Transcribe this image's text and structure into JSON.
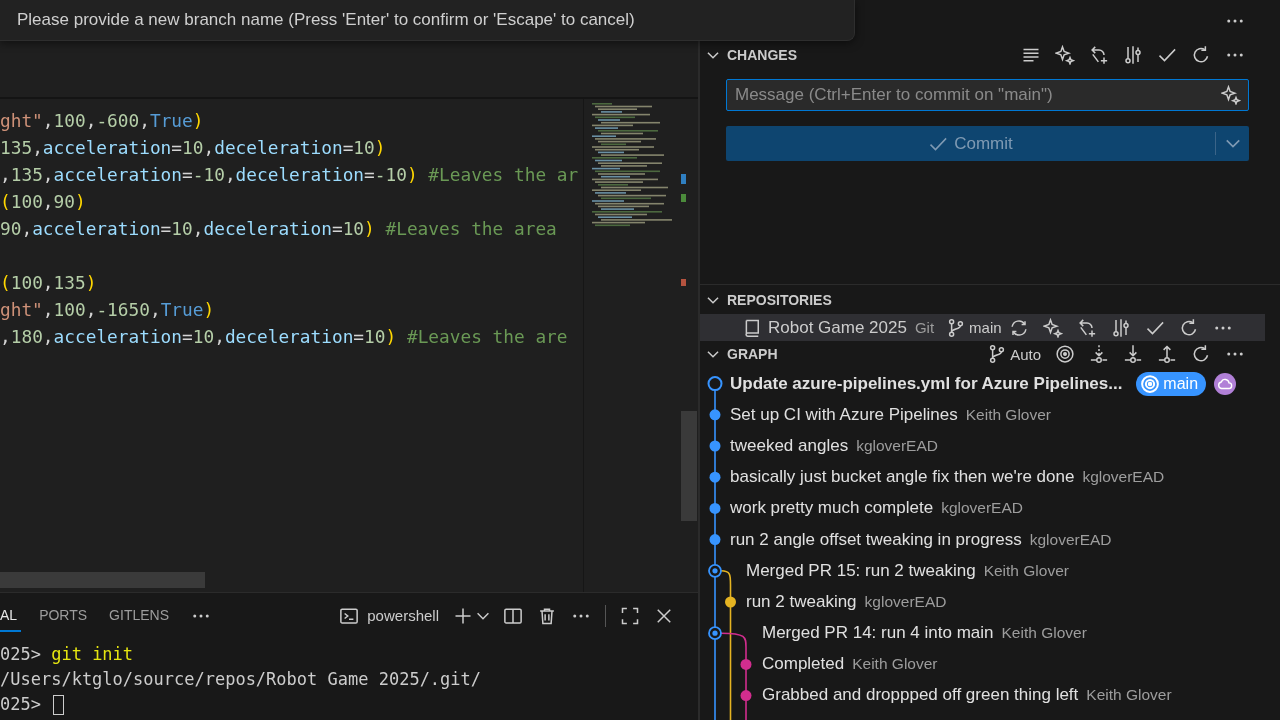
{
  "quick_input": {
    "message": "Please provide a new branch name (Press 'Enter' to confirm or 'Escape' to cancel)"
  },
  "editor": {
    "lines": [
      {
        "kind": "code",
        "segments": [
          {
            "kind": "str",
            "text": "ght\""
          },
          {
            "kind": "punc",
            "text": ","
          },
          {
            "kind": "num",
            "text": "100"
          },
          {
            "kind": "punc",
            "text": ","
          },
          {
            "kind": "num",
            "text": "-600"
          },
          {
            "kind": "punc",
            "text": ","
          },
          {
            "kind": "kw",
            "text": "True"
          },
          {
            "kind": "paren",
            "text": ")"
          }
        ]
      },
      {
        "kind": "code",
        "segments": [
          {
            "kind": "num",
            "text": "135"
          },
          {
            "kind": "punc",
            "text": ","
          },
          {
            "kind": "param",
            "text": "acceleration"
          },
          {
            "kind": "punc",
            "text": "="
          },
          {
            "kind": "num",
            "text": "10"
          },
          {
            "kind": "punc",
            "text": ","
          },
          {
            "kind": "param",
            "text": "deceleration"
          },
          {
            "kind": "punc",
            "text": "="
          },
          {
            "kind": "num",
            "text": "10"
          },
          {
            "kind": "paren",
            "text": ")"
          }
        ]
      },
      {
        "kind": "code",
        "segments": [
          {
            "kind": "punc",
            "text": ","
          },
          {
            "kind": "num",
            "text": "135"
          },
          {
            "kind": "punc",
            "text": ","
          },
          {
            "kind": "param",
            "text": "acceleration"
          },
          {
            "kind": "punc",
            "text": "="
          },
          {
            "kind": "num",
            "text": "-10"
          },
          {
            "kind": "punc",
            "text": ","
          },
          {
            "kind": "param",
            "text": "deceleration"
          },
          {
            "kind": "punc",
            "text": "="
          },
          {
            "kind": "num",
            "text": "-10"
          },
          {
            "kind": "paren",
            "text": ")"
          },
          {
            "kind": "com",
            "text": " #Leaves the ar"
          }
        ]
      },
      {
        "kind": "code",
        "segments": [
          {
            "kind": "paren",
            "text": "("
          },
          {
            "kind": "num",
            "text": "100"
          },
          {
            "kind": "punc",
            "text": ","
          },
          {
            "kind": "num",
            "text": "90"
          },
          {
            "kind": "paren",
            "text": ")"
          }
        ]
      },
      {
        "kind": "code",
        "segments": [
          {
            "kind": "num",
            "text": "90"
          },
          {
            "kind": "punc",
            "text": ","
          },
          {
            "kind": "param",
            "text": "acceleration"
          },
          {
            "kind": "punc",
            "text": "="
          },
          {
            "kind": "num",
            "text": "10"
          },
          {
            "kind": "punc",
            "text": ","
          },
          {
            "kind": "param",
            "text": "deceleration"
          },
          {
            "kind": "punc",
            "text": "="
          },
          {
            "kind": "num",
            "text": "10"
          },
          {
            "kind": "paren",
            "text": ")"
          },
          {
            "kind": "com",
            "text": " #Leaves the area"
          }
        ]
      },
      {
        "kind": "blank"
      },
      {
        "kind": "code",
        "segments": [
          {
            "kind": "paren",
            "text": "("
          },
          {
            "kind": "num",
            "text": "100"
          },
          {
            "kind": "punc",
            "text": ","
          },
          {
            "kind": "num",
            "text": "135"
          },
          {
            "kind": "paren",
            "text": ")"
          }
        ]
      },
      {
        "kind": "code",
        "segments": [
          {
            "kind": "str",
            "text": "ght\""
          },
          {
            "kind": "punc",
            "text": ","
          },
          {
            "kind": "num",
            "text": "100"
          },
          {
            "kind": "punc",
            "text": ","
          },
          {
            "kind": "num",
            "text": "-1650"
          },
          {
            "kind": "punc",
            "text": ","
          },
          {
            "kind": "kw",
            "text": "True"
          },
          {
            "kind": "paren",
            "text": ")"
          }
        ]
      },
      {
        "kind": "code",
        "segments": [
          {
            "kind": "punc",
            "text": ","
          },
          {
            "kind": "num",
            "text": "180"
          },
          {
            "kind": "punc",
            "text": ","
          },
          {
            "kind": "param",
            "text": "acceleration"
          },
          {
            "kind": "punc",
            "text": "="
          },
          {
            "kind": "num",
            "text": "10"
          },
          {
            "kind": "punc",
            "text": ","
          },
          {
            "kind": "param",
            "text": "deceleration"
          },
          {
            "kind": "punc",
            "text": "="
          },
          {
            "kind": "num",
            "text": "10"
          },
          {
            "kind": "paren",
            "text": ")"
          },
          {
            "kind": "com",
            "text": " #Leaves the are"
          }
        ]
      }
    ]
  },
  "panel": {
    "tabs": [
      {
        "label": "AL",
        "selected": true
      },
      {
        "label": "PORTS",
        "selected": false
      },
      {
        "label": "GITLENS",
        "selected": false
      }
    ],
    "terminal_name": "powershell",
    "terminal_lines": [
      {
        "kind": "input",
        "prompt": "025>",
        "command": "git init"
      },
      {
        "kind": "output",
        "text": "/Users/ktglo/source/repos/Robot Game 2025/.git/"
      },
      {
        "kind": "input",
        "prompt": "025>",
        "cursor": true
      }
    ]
  },
  "scm": {
    "changes": {
      "title": "CHANGES",
      "expanded": true,
      "message_placeholder": "Message (Ctrl+Enter to commit on \"main\")",
      "commit_label": "Commit",
      "commit_disabled": true
    },
    "repositories": {
      "title": "REPOSITORIES",
      "expanded": true,
      "items": [
        {
          "name": "Robot Game 2025",
          "provider": "Git",
          "branch": "main",
          "selected": true
        }
      ]
    },
    "graph": {
      "title": "GRAPH",
      "expanded": true,
      "mode": "Auto",
      "commits": [
        {
          "message": "Update azure-pipelines.yml for Azure Pipelines...",
          "kind": "head",
          "color": "#3794ff",
          "branch": "main"
        },
        {
          "message": "Set up CI with Azure Pipelines",
          "author": "Keith Glover",
          "kind": "commit",
          "color": "#3794ff"
        },
        {
          "message": "tweeked angles",
          "author": "kgloverEAD",
          "kind": "commit",
          "color": "#3794ff"
        },
        {
          "message": "basically just bucket angle fix then we're done",
          "author": "kgloverEAD",
          "kind": "commit",
          "color": "#3794ff"
        },
        {
          "message": "work pretty much complete",
          "author": "kgloverEAD",
          "kind": "commit",
          "color": "#3794ff"
        },
        {
          "message": "run 2 angle offset tweaking in progress",
          "author": "kgloverEAD",
          "kind": "commit",
          "color": "#3794ff"
        },
        {
          "message": "Merged PR 15: run 2 tweaking",
          "author": "Keith Glover",
          "kind": "merge",
          "color": "#3794ff",
          "children": [
            {
              "message": "run 2 tweaking",
              "author": "kgloverEAD",
              "kind": "commit",
              "color": "#e5b422"
            }
          ]
        },
        {
          "message": "Merged PR 14: run 4 into main",
          "author": "Keith Glover",
          "kind": "merge",
          "color": "#3794ff",
          "children": [
            {
              "message": "Completed",
              "author": "Keith Glover",
              "kind": "commit",
              "color": "#d22d8e"
            },
            {
              "message": "Grabbed and droppped off green thing left",
              "author": "Keith Glover",
              "kind": "commit",
              "color": "#d22d8e"
            }
          ]
        }
      ]
    }
  }
}
